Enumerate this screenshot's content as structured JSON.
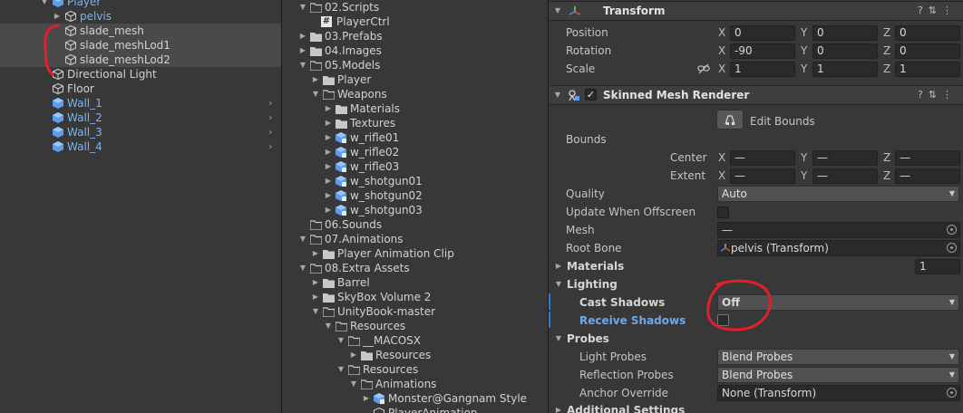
{
  "hierarchy": {
    "items": [
      {
        "label": "Player",
        "blue": true
      },
      {
        "label": "pelvis",
        "blue": true
      },
      {
        "label": "slade_mesh",
        "blue": false
      },
      {
        "label": "slade_meshLod1",
        "blue": false
      },
      {
        "label": "slade_meshLod2",
        "blue": false
      },
      {
        "label": "Directional Light",
        "blue": false
      },
      {
        "label": "Floor",
        "blue": false
      },
      {
        "label": "Wall_1",
        "blue": true
      },
      {
        "label": "Wall_2",
        "blue": true
      },
      {
        "label": "Wall_3",
        "blue": true
      },
      {
        "label": "Wall_4",
        "blue": true
      }
    ]
  },
  "project": {
    "items": [
      {
        "label": "02.Scripts"
      },
      {
        "label": "PlayerCtrl"
      },
      {
        "label": "03.Prefabs"
      },
      {
        "label": "04.Images"
      },
      {
        "label": "05.Models"
      },
      {
        "label": "Player"
      },
      {
        "label": "Weapons"
      },
      {
        "label": "Materials"
      },
      {
        "label": "Textures"
      },
      {
        "label": "w_rifle01"
      },
      {
        "label": "w_rifle02"
      },
      {
        "label": "w_rifle03"
      },
      {
        "label": "w_shotgun01"
      },
      {
        "label": "w_shotgun02"
      },
      {
        "label": "w_shotgun03"
      },
      {
        "label": "06.Sounds"
      },
      {
        "label": "07.Animations"
      },
      {
        "label": "Player Animation Clip"
      },
      {
        "label": "08.Extra Assets"
      },
      {
        "label": "Barrel"
      },
      {
        "label": "SkyBox Volume 2"
      },
      {
        "label": "UnityBook-master"
      },
      {
        "label": "Resources"
      },
      {
        "label": "__MACOSX"
      },
      {
        "label": "Resources"
      },
      {
        "label": "Resources"
      },
      {
        "label": "Animations"
      },
      {
        "label": "Monster@Gangnam Style"
      },
      {
        "label": "PlayerAnimation"
      }
    ]
  },
  "inspector": {
    "transform": {
      "title": "Transform",
      "position_label": "Position",
      "rotation_label": "Rotation",
      "scale_label": "Scale",
      "position": {
        "x": "0",
        "y": "0",
        "z": "0"
      },
      "rotation": {
        "x": "-90",
        "y": "0",
        "z": "0"
      },
      "scale": {
        "x": "1",
        "y": "1",
        "z": "1"
      }
    },
    "axes": {
      "x": "X",
      "y": "Y",
      "z": "Z"
    },
    "smr": {
      "title": "Skinned Mesh Renderer",
      "edit_bounds": "Edit Bounds",
      "bounds": "Bounds",
      "center": "Center",
      "extent": "Extent",
      "empty": "—",
      "quality_label": "Quality",
      "quality_value": "Auto",
      "update_offscreen": "Update When Offscreen",
      "mesh_label": "Mesh",
      "mesh_value": "—",
      "root_bone_label": "Root Bone",
      "root_bone_value": "pelvis (Transform)",
      "materials": "Materials",
      "materials_count": "1",
      "lighting": "Lighting",
      "cast_shadows_label": "Cast Shadows",
      "cast_shadows_value": "Off",
      "receive_shadows_label": "Receive Shadows",
      "probes": "Probes",
      "light_probes_label": "Light Probes",
      "light_probes_value": "Blend Probes",
      "reflection_probes_label": "Reflection Probes",
      "reflection_probes_value": "Blend Probes",
      "anchor_override_label": "Anchor Override",
      "anchor_override_value": "None (Transform)",
      "additional_settings": "Additional Settings"
    }
  },
  "colors": {
    "annotation": "#e0202a",
    "selected_blue": "#7eb3f2"
  }
}
